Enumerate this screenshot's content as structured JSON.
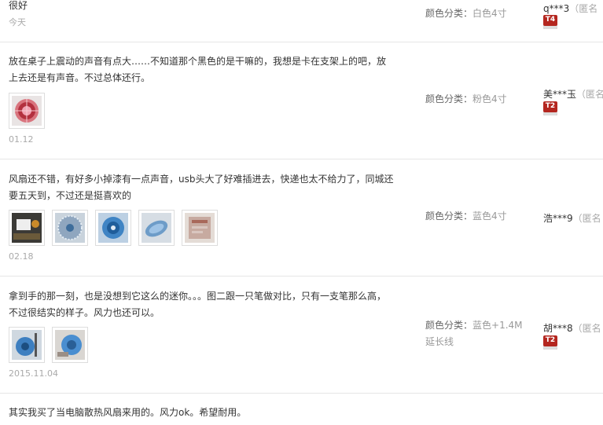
{
  "reviews": [
    {
      "content": "很好",
      "date": "今天",
      "sku_label": "颜色分类：",
      "sku_value": "白色4寸",
      "user_name": "q***3",
      "anon": "（匿名",
      "badge": "T4",
      "thumbs": []
    },
    {
      "content": "放在桌子上震动的声音有点大……不知道那个黑色的是干嘛的，我想是卡在支架上的吧，放上去还是有声音。不过总体还行。",
      "date": "01.12",
      "sku_label": "颜色分类：",
      "sku_value": "粉色4寸",
      "user_name": "美***玉",
      "anon": "（匿名",
      "badge": "T2",
      "thumbs": [
        "pink-fan"
      ]
    },
    {
      "content": "风扇还不错，有好多小掉漆有一点声音，usb头大了好难插进去，快递也太不给力了，同城还要五天到，不过还是挺喜欢的",
      "date": "02.18",
      "sku_label": "颜色分类：",
      "sku_value": "蓝色4寸",
      "user_name": "浩***9",
      "anon": "（匿名",
      "badge": "",
      "thumbs": [
        "dark-desk",
        "grill-blue",
        "fan-blue",
        "fan-side",
        "box"
      ]
    },
    {
      "content": "拿到手的那一刻，也是没想到它这么的迷你。。。图二跟一只笔做对比，只有一支笔那么高，不过很结实的样子。风力也还可以。",
      "date": "2015.11.04",
      "sku_label": "颜色分类：",
      "sku_value": "蓝色+1.4M延长线",
      "user_name": "胡***8",
      "anon": "（匿名",
      "badge": "T2",
      "thumbs": [
        "blue-pen",
        "blue-fan"
      ]
    },
    {
      "content": "其实我买了当电脑散热风扇来用的。风力ok。希望耐用。",
      "date": "",
      "sku_label": "",
      "sku_value": "",
      "user_name": "",
      "anon": "",
      "badge": "",
      "thumbs": []
    }
  ],
  "colors": {
    "badge": "#b4261f",
    "sku_value": "#999999",
    "date": "#aaaaaa"
  }
}
